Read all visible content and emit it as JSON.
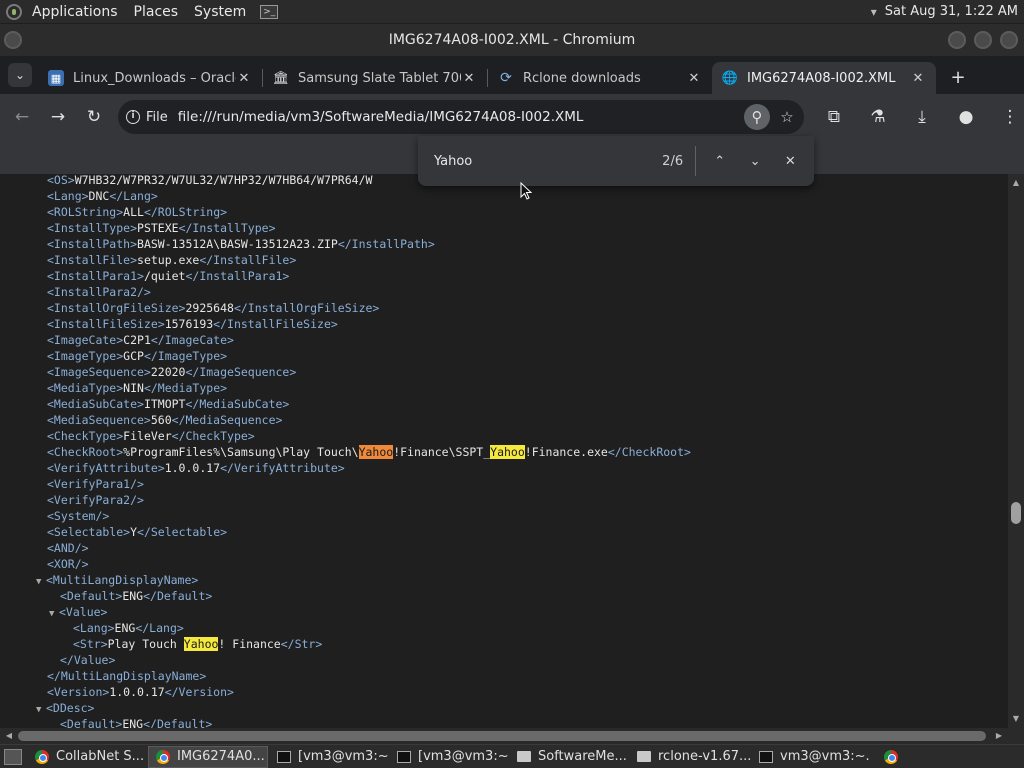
{
  "top_panel": {
    "applications": "Applications",
    "places": "Places",
    "system": "System",
    "clock": "Sat Aug 31,  1:22 AM"
  },
  "window": {
    "title": "IMG6274A08-I002.XML - Chromium"
  },
  "tabs": [
    {
      "label": "Linux_Downloads – Oracle",
      "icon": "oracle-wiki-icon",
      "active": false
    },
    {
      "label": "Samsung Slate Tablet 700",
      "icon": "samsung-bank-icon",
      "active": false
    },
    {
      "label": "Rclone downloads",
      "icon": "rclone-icon",
      "active": false
    },
    {
      "label": "IMG6274A08-I002.XML",
      "icon": "globe-icon",
      "active": true
    }
  ],
  "toolbar": {
    "scheme_label": "File",
    "url": "file:///run/media/vm3/SoftwareMedia/IMG6274A08-I002.XML"
  },
  "find_bar": {
    "query": "Yahoo",
    "count": "2/6"
  },
  "xml_lines": [
    {
      "indent": 0,
      "toggle": "",
      "segments": [
        {
          "t": "tag",
          "v": "<OS>"
        },
        {
          "t": "txt",
          "v": "W7HB32/W7PR32/W7UL32/W7HP32/W7HB64/W7PR64/W"
        }
      ]
    },
    {
      "indent": 0,
      "toggle": "",
      "segments": [
        {
          "t": "tag",
          "v": "<Lang>"
        },
        {
          "t": "txt",
          "v": "DNC"
        },
        {
          "t": "tag",
          "v": "</Lang>"
        }
      ]
    },
    {
      "indent": 0,
      "toggle": "",
      "segments": [
        {
          "t": "tag",
          "v": "<ROLString>"
        },
        {
          "t": "txt",
          "v": "ALL"
        },
        {
          "t": "tag",
          "v": "</ROLString>"
        }
      ]
    },
    {
      "indent": 0,
      "toggle": "",
      "segments": [
        {
          "t": "tag",
          "v": "<InstallType>"
        },
        {
          "t": "txt",
          "v": "PSTEXE"
        },
        {
          "t": "tag",
          "v": "</InstallType>"
        }
      ]
    },
    {
      "indent": 0,
      "toggle": "",
      "segments": [
        {
          "t": "tag",
          "v": "<InstallPath>"
        },
        {
          "t": "txt",
          "v": "BASW-13512A\\BASW-13512A23.ZIP"
        },
        {
          "t": "tag",
          "v": "</InstallPath>"
        }
      ]
    },
    {
      "indent": 0,
      "toggle": "",
      "segments": [
        {
          "t": "tag",
          "v": "<InstallFile>"
        },
        {
          "t": "txt",
          "v": "setup.exe"
        },
        {
          "t": "tag",
          "v": "</InstallFile>"
        }
      ]
    },
    {
      "indent": 0,
      "toggle": "",
      "segments": [
        {
          "t": "tag",
          "v": "<InstallPara1>"
        },
        {
          "t": "txt",
          "v": "/quiet"
        },
        {
          "t": "tag",
          "v": "</InstallPara1>"
        }
      ]
    },
    {
      "indent": 0,
      "toggle": "",
      "segments": [
        {
          "t": "tag",
          "v": "<InstallPara2/>"
        }
      ]
    },
    {
      "indent": 0,
      "toggle": "",
      "segments": [
        {
          "t": "tag",
          "v": "<InstallOrgFileSize>"
        },
        {
          "t": "txt",
          "v": "2925648"
        },
        {
          "t": "tag",
          "v": "</InstallOrgFileSize>"
        }
      ]
    },
    {
      "indent": 0,
      "toggle": "",
      "segments": [
        {
          "t": "tag",
          "v": "<InstallFileSize>"
        },
        {
          "t": "txt",
          "v": "1576193"
        },
        {
          "t": "tag",
          "v": "</InstallFileSize>"
        }
      ]
    },
    {
      "indent": 0,
      "toggle": "",
      "segments": [
        {
          "t": "tag",
          "v": "<ImageCate>"
        },
        {
          "t": "txt",
          "v": "C2P1"
        },
        {
          "t": "tag",
          "v": "</ImageCate>"
        }
      ]
    },
    {
      "indent": 0,
      "toggle": "",
      "segments": [
        {
          "t": "tag",
          "v": "<ImageType>"
        },
        {
          "t": "txt",
          "v": "GCP"
        },
        {
          "t": "tag",
          "v": "</ImageType>"
        }
      ]
    },
    {
      "indent": 0,
      "toggle": "",
      "segments": [
        {
          "t": "tag",
          "v": "<ImageSequence>"
        },
        {
          "t": "txt",
          "v": "22020"
        },
        {
          "t": "tag",
          "v": "</ImageSequence>"
        }
      ]
    },
    {
      "indent": 0,
      "toggle": "",
      "segments": [
        {
          "t": "tag",
          "v": "<MediaType>"
        },
        {
          "t": "txt",
          "v": "NIN"
        },
        {
          "t": "tag",
          "v": "</MediaType>"
        }
      ]
    },
    {
      "indent": 0,
      "toggle": "",
      "segments": [
        {
          "t": "tag",
          "v": "<MediaSubCate>"
        },
        {
          "t": "txt",
          "v": "ITMOPT"
        },
        {
          "t": "tag",
          "v": "</MediaSubCate>"
        }
      ]
    },
    {
      "indent": 0,
      "toggle": "",
      "segments": [
        {
          "t": "tag",
          "v": "<MediaSequence>"
        },
        {
          "t": "txt",
          "v": "560"
        },
        {
          "t": "tag",
          "v": "</MediaSequence>"
        }
      ]
    },
    {
      "indent": 0,
      "toggle": "",
      "segments": [
        {
          "t": "tag",
          "v": "<CheckType>"
        },
        {
          "t": "txt",
          "v": "FileVer"
        },
        {
          "t": "tag",
          "v": "</CheckType>"
        }
      ]
    },
    {
      "indent": 0,
      "toggle": "",
      "segments": [
        {
          "t": "tag",
          "v": "<CheckRoot>"
        },
        {
          "t": "txt",
          "v": "%ProgramFiles%\\Samsung\\Play Touch\\"
        },
        {
          "t": "hlc",
          "v": "Yahoo"
        },
        {
          "t": "txt",
          "v": "!Finance\\SSPT_"
        },
        {
          "t": "hl",
          "v": "Yahoo"
        },
        {
          "t": "txt",
          "v": "!Finance.exe"
        },
        {
          "t": "tag",
          "v": "</CheckRoot>"
        }
      ]
    },
    {
      "indent": 0,
      "toggle": "",
      "segments": [
        {
          "t": "tag",
          "v": "<VerifyAttribute>"
        },
        {
          "t": "txt",
          "v": "1.0.0.17"
        },
        {
          "t": "tag",
          "v": "</VerifyAttribute>"
        }
      ]
    },
    {
      "indent": 0,
      "toggle": "",
      "segments": [
        {
          "t": "tag",
          "v": "<VerifyPara1/>"
        }
      ]
    },
    {
      "indent": 0,
      "toggle": "",
      "segments": [
        {
          "t": "tag",
          "v": "<VerifyPara2/>"
        }
      ]
    },
    {
      "indent": 0,
      "toggle": "",
      "segments": [
        {
          "t": "tag",
          "v": "<System/>"
        }
      ]
    },
    {
      "indent": 0,
      "toggle": "",
      "segments": [
        {
          "t": "tag",
          "v": "<Selectable>"
        },
        {
          "t": "txt",
          "v": "Y"
        },
        {
          "t": "tag",
          "v": "</Selectable>"
        }
      ]
    },
    {
      "indent": 0,
      "toggle": "",
      "segments": [
        {
          "t": "tag",
          "v": "<AND/>"
        }
      ]
    },
    {
      "indent": 0,
      "toggle": "",
      "segments": [
        {
          "t": "tag",
          "v": "<XOR/>"
        }
      ]
    },
    {
      "indent": 0,
      "toggle": "▼",
      "segments": [
        {
          "t": "tag",
          "v": "<MultiLangDisplayName>"
        }
      ]
    },
    {
      "indent": 1,
      "toggle": "",
      "segments": [
        {
          "t": "tag",
          "v": "<Default>"
        },
        {
          "t": "txt",
          "v": "ENG"
        },
        {
          "t": "tag",
          "v": "</Default>"
        }
      ]
    },
    {
      "indent": 1,
      "toggle": "▼",
      "segments": [
        {
          "t": "tag",
          "v": "<Value>"
        }
      ]
    },
    {
      "indent": 2,
      "toggle": "",
      "segments": [
        {
          "t": "tag",
          "v": "<Lang>"
        },
        {
          "t": "txt",
          "v": "ENG"
        },
        {
          "t": "tag",
          "v": "</Lang>"
        }
      ]
    },
    {
      "indent": 2,
      "toggle": "",
      "segments": [
        {
          "t": "tag",
          "v": "<Str>"
        },
        {
          "t": "txt",
          "v": "Play Touch "
        },
        {
          "t": "hl",
          "v": "Yahoo"
        },
        {
          "t": "txt",
          "v": "! Finance"
        },
        {
          "t": "tag",
          "v": "</Str>"
        }
      ]
    },
    {
      "indent": 1,
      "toggle": "",
      "segments": [
        {
          "t": "tag",
          "v": "</Value>"
        }
      ]
    },
    {
      "indent": 0,
      "toggle": "",
      "segments": [
        {
          "t": "tag",
          "v": "</MultiLangDisplayName>"
        }
      ]
    },
    {
      "indent": 0,
      "toggle": "",
      "segments": [
        {
          "t": "tag",
          "v": "<Version>"
        },
        {
          "t": "txt",
          "v": "1.0.0.17"
        },
        {
          "t": "tag",
          "v": "</Version>"
        }
      ]
    },
    {
      "indent": 0,
      "toggle": "▼",
      "segments": [
        {
          "t": "tag",
          "v": "<DDesc>"
        }
      ]
    },
    {
      "indent": 1,
      "toggle": "",
      "segments": [
        {
          "t": "tag",
          "v": "<Default>"
        },
        {
          "t": "txt",
          "v": "ENG"
        },
        {
          "t": "tag",
          "v": "</Default>"
        }
      ]
    }
  ],
  "taskbar": [
    {
      "label": "CollabNet S...",
      "icon": "chrome-icon",
      "active": false
    },
    {
      "label": "IMG6274A0...",
      "icon": "chrome-icon",
      "active": true
    },
    {
      "label": "[vm3@vm3:~]",
      "icon": "terminal-icon",
      "active": false
    },
    {
      "label": "[vm3@vm3:~]",
      "icon": "terminal-icon",
      "active": false
    },
    {
      "label": "SoftwareMe...",
      "icon": "folder-icon",
      "active": false
    },
    {
      "label": "rclone-v1.67...",
      "icon": "folder-icon",
      "active": false
    },
    {
      "label": "vm3@vm3:~...",
      "icon": "terminal-icon",
      "active": false
    }
  ]
}
